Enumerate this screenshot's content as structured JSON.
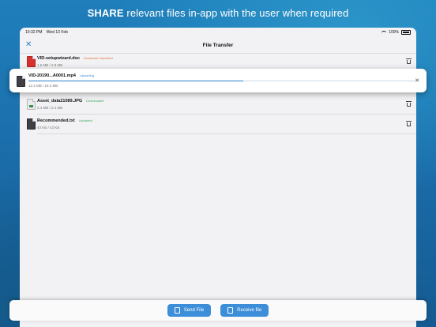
{
  "headline": {
    "bold": "SHARE",
    "rest": " relevant files in-app with the user when required"
  },
  "status_bar": {
    "time": "10:32 PM",
    "date": "Wed 13 Feb",
    "battery": "100%"
  },
  "navbar": {
    "title": "File Transfer"
  },
  "files": [
    {
      "name": "VID-setupwizard.doc",
      "status": "Download Cancelled",
      "size": "1.6 MB / 2.8 MB",
      "type": "doc"
    },
    {
      "name": "Asset_data21089.JPG",
      "status": "Downloaded",
      "size": "2.4 MB / 2.4 MB",
      "type": "img"
    },
    {
      "name": "Recommended.txt",
      "status": "Uploaded",
      "size": "43 KB / 43 KB",
      "type": "txt"
    }
  ],
  "uploading": {
    "name": "VID-20190...A0001.mp4",
    "status": "Uploading",
    "size": "12.2 MB / 16.3 MB",
    "progress": 0.55
  },
  "actions": {
    "send": "Send File",
    "receive": "Receive file"
  },
  "colors": {
    "accent": "#3d8ed8",
    "cancelled": "#e56f3c",
    "done": "#41a85f"
  }
}
